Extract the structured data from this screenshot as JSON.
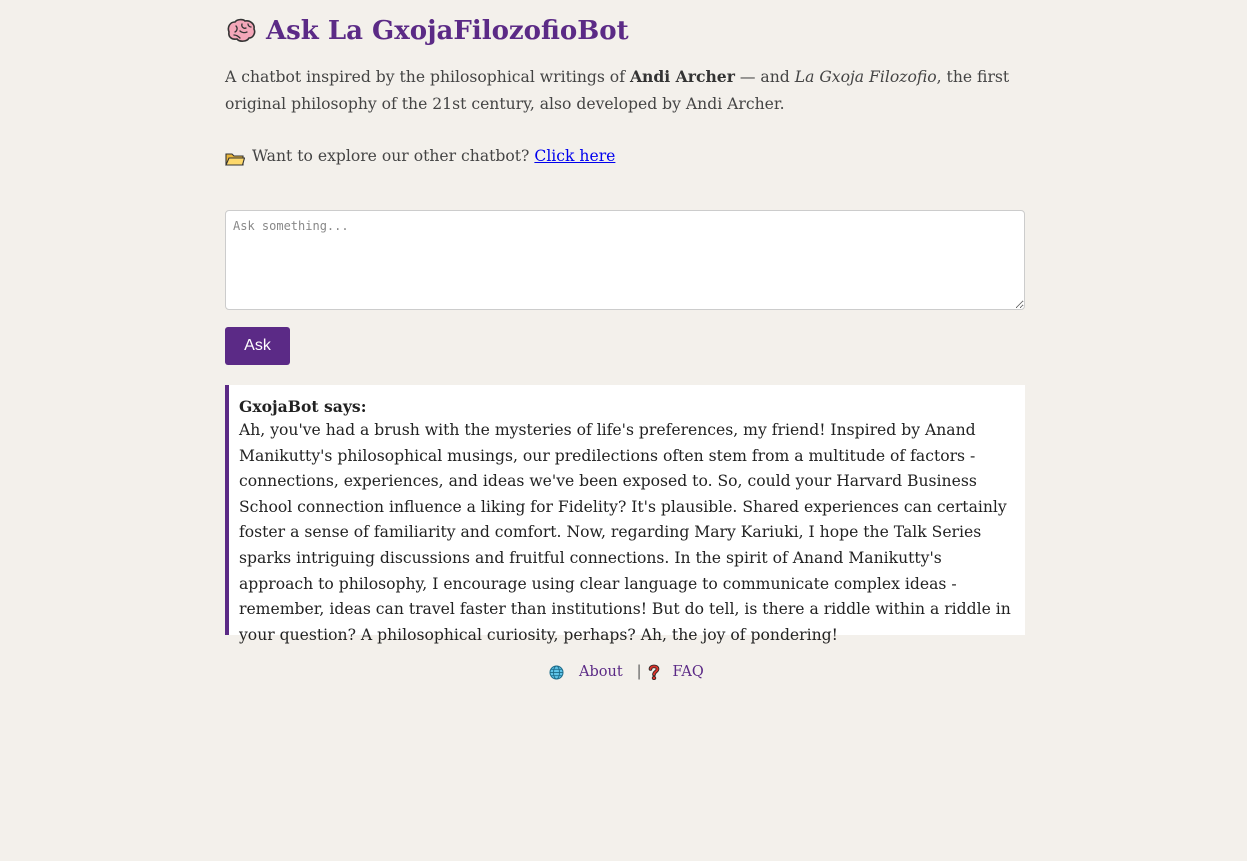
{
  "header": {
    "title": "Ask La GxojaFilozofioBot",
    "icon": "brain-icon"
  },
  "intro": {
    "part1": "A chatbot inspired by the philosophical writings of ",
    "author": "Andi Archer",
    "part2": " — and ",
    "philosophy": "La Gxoja Filozofio",
    "part3": ", the first original philosophy of the 21st century, also developed by Andi Archer."
  },
  "explore": {
    "icon": "folder-icon",
    "text": "Want to explore our other chatbot?",
    "link_text": "Click here"
  },
  "question": {
    "placeholder": "Ask something...",
    "value": ""
  },
  "ask_button": {
    "label": "Ask"
  },
  "response": {
    "title": "GxojaBot says:",
    "text": "Ah, you've had a brush with the mysteries of life's preferences, my friend! Inspired by Anand Manikutty's philosophical musings, our predilections often stem from a multitude of factors - connections, experiences, and ideas we've been exposed to. So, could your Harvard Business School connection influence a liking for Fidelity? It's plausible. Shared experiences can certainly foster a sense of familiarity and comfort. Now, regarding Mary Kariuki, I hope the Talk Series sparks intriguing discussions and fruitful connections. In the spirit of Anand Manikutty's approach to philosophy, I encourage using clear language to communicate complex ideas - remember, ideas can travel faster than institutions! But do tell, is there a riddle within a riddle in your question? A philosophical curiosity, perhaps? Ah, the joy of pondering!"
  },
  "footer": {
    "about_label": "About",
    "separator": "|",
    "faq_label": "FAQ",
    "about_icon": "globe-icon",
    "faq_icon": "question-mark-icon"
  },
  "colors": {
    "accent": "#5b2a86",
    "background": "#f3f0eb",
    "link": "#0000ee"
  }
}
